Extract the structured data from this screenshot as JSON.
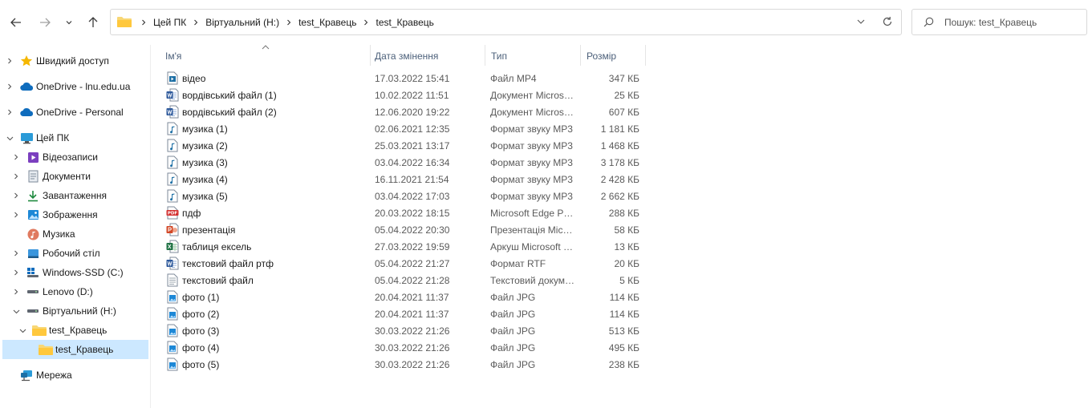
{
  "address": {
    "crumbs": [
      "Цей ПК",
      "Віртуальний (H:)",
      "test_Кравець",
      "test_Кравець"
    ]
  },
  "search": {
    "placeholder": "Пошук: test_Кравець"
  },
  "nav": {
    "items": [
      {
        "label": "Швидкий доступ",
        "icon": "star-icon"
      },
      {
        "label": "OneDrive - lnu.edu.ua",
        "icon": "cloud-icon"
      },
      {
        "label": "OneDrive - Personal",
        "icon": "cloud-icon"
      },
      {
        "label": "Цей ПК",
        "icon": "monitor-icon"
      },
      {
        "label": "Відеозаписи",
        "icon": "video-icon"
      },
      {
        "label": "Документи",
        "icon": "document-icon"
      },
      {
        "label": "Завантаження",
        "icon": "download-icon"
      },
      {
        "label": "Зображення",
        "icon": "image-icon"
      },
      {
        "label": "Музика",
        "icon": "music-icon"
      },
      {
        "label": "Робочий стіл",
        "icon": "desktop-icon"
      },
      {
        "label": "Windows-SSD (C:)",
        "icon": "windows-drive-icon"
      },
      {
        "label": "Lenovo (D:)",
        "icon": "drive-icon"
      },
      {
        "label": "Віртуальний (H:)",
        "icon": "drive-icon"
      },
      {
        "label": "test_Кравець",
        "icon": "folder-icon"
      },
      {
        "label": "test_Кравець",
        "icon": "folder-icon"
      },
      {
        "label": "Мережа",
        "icon": "network-icon"
      }
    ]
  },
  "columns": {
    "name": "Ім'я",
    "date": "Дата змінення",
    "type": "Тип",
    "size": "Розмір"
  },
  "files": [
    {
      "name": "відео",
      "date": "17.03.2022 15:41",
      "type": "Файл MP4",
      "size": "347 КБ",
      "icon": "video-file-icon"
    },
    {
      "name": "вордівський файл (1)",
      "date": "10.02.2022 11:51",
      "type": "Документ Microsoft Word",
      "size": "25 КБ",
      "icon": "word-file-icon"
    },
    {
      "name": "вордівський файл (2)",
      "date": "12.06.2020 19:22",
      "type": "Документ Microsoft Word",
      "size": "607 КБ",
      "icon": "word-file-icon"
    },
    {
      "name": "музика (1)",
      "date": "02.06.2021 12:35",
      "type": "Формат звуку MP3",
      "size": "1 181 КБ",
      "icon": "audio-file-icon"
    },
    {
      "name": "музика (2)",
      "date": "25.03.2021 13:17",
      "type": "Формат звуку MP3",
      "size": "1 468 КБ",
      "icon": "audio-file-icon"
    },
    {
      "name": "музика (3)",
      "date": "03.04.2022 16:34",
      "type": "Формат звуку MP3",
      "size": "3 178 КБ",
      "icon": "audio-file-icon"
    },
    {
      "name": "музика (4)",
      "date": "16.11.2021 21:54",
      "type": "Формат звуку MP3",
      "size": "2 428 КБ",
      "icon": "audio-file-icon"
    },
    {
      "name": "музика (5)",
      "date": "03.04.2022 17:03",
      "type": "Формат звуку MP3",
      "size": "2 662 КБ",
      "icon": "audio-file-icon"
    },
    {
      "name": "пдф",
      "date": "20.03.2022 18:15",
      "type": "Microsoft Edge PDF Document",
      "size": "288 КБ",
      "icon": "pdf-file-icon"
    },
    {
      "name": "презентація",
      "date": "05.04.2022 20:30",
      "type": "Презентація Microsoft PowerPoint",
      "size": "58 КБ",
      "icon": "powerpoint-file-icon"
    },
    {
      "name": "таблиця ексель",
      "date": "27.03.2022 19:59",
      "type": "Аркуш Microsoft Excel",
      "size": "13 КБ",
      "icon": "excel-file-icon"
    },
    {
      "name": "текстовий файл ртф",
      "date": "05.04.2022 21:27",
      "type": "Формат RTF",
      "size": "20 КБ",
      "icon": "word-file-icon"
    },
    {
      "name": "текстовий файл",
      "date": "05.04.2022 21:28",
      "type": "Текстовий документ",
      "size": "5 КБ",
      "icon": "text-file-icon"
    },
    {
      "name": "фото (1)",
      "date": "20.04.2021 11:37",
      "type": "Файл JPG",
      "size": "114 КБ",
      "icon": "image-file-icon"
    },
    {
      "name": "фото (2)",
      "date": "20.04.2021 11:37",
      "type": "Файл JPG",
      "size": "114 КБ",
      "icon": "image-file-icon"
    },
    {
      "name": "фото (3)",
      "date": "30.03.2022 21:26",
      "type": "Файл JPG",
      "size": "513 КБ",
      "icon": "image-file-icon"
    },
    {
      "name": "фото (4)",
      "date": "30.03.2022 21:26",
      "type": "Файл JPG",
      "size": "495 КБ",
      "icon": "image-file-icon"
    },
    {
      "name": "фото (5)",
      "date": "30.03.2022 21:26",
      "type": "Файл JPG",
      "size": "238 КБ",
      "icon": "image-file-icon"
    }
  ],
  "colors": {
    "selection": "#cce8ff",
    "header_text": "#4c607a",
    "folder": "#f8d775",
    "word": "#2b579a",
    "excel": "#217346",
    "powerpoint": "#d24726",
    "pdf": "#d32f2f"
  }
}
